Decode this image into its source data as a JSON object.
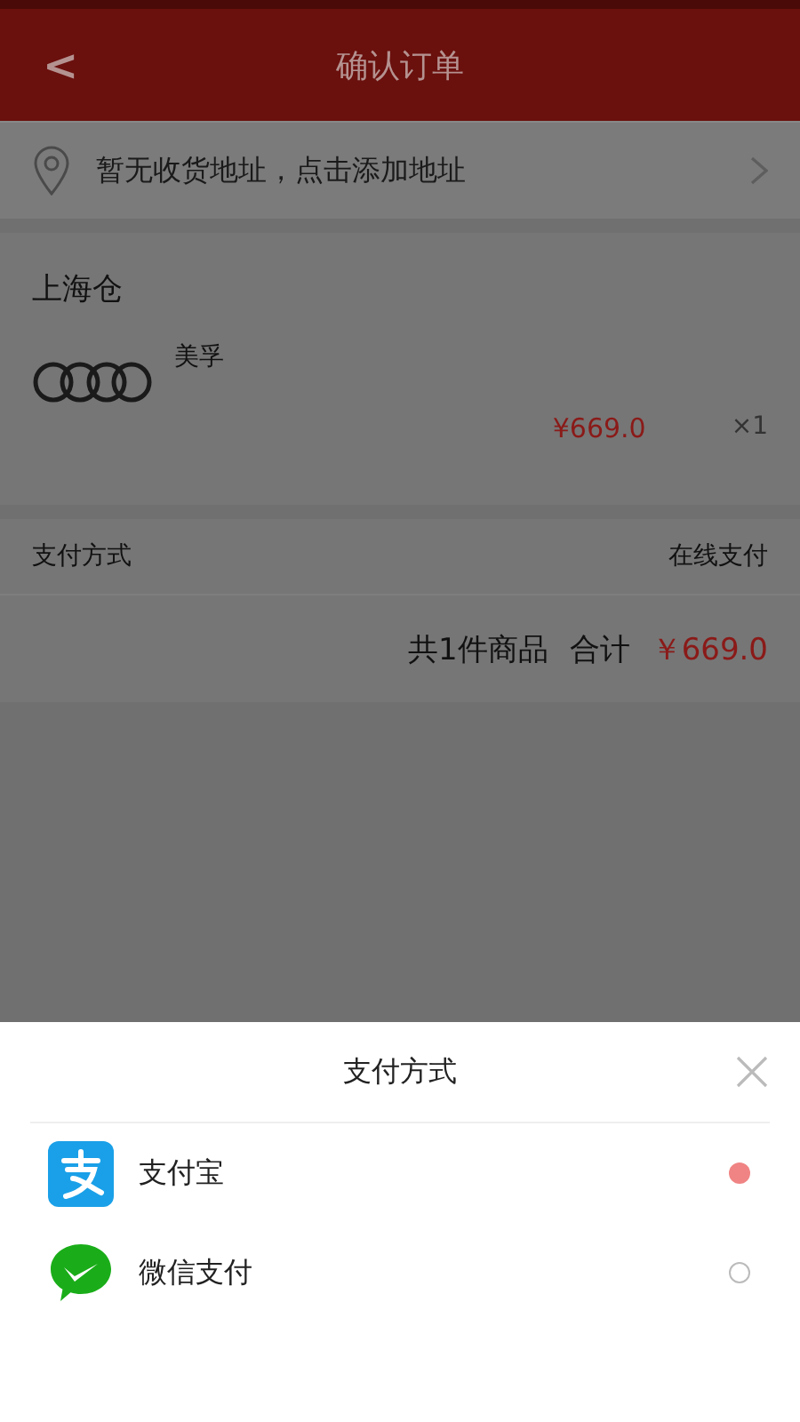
{
  "header": {
    "back": "<",
    "title": "确认订单"
  },
  "address": {
    "text": "暂无收货地址，点击添加地址"
  },
  "order": {
    "warehouse": "上海仓",
    "items": [
      {
        "name": "美孚",
        "price": "¥669.0",
        "quantity": "×1"
      }
    ],
    "payment_label": "支付方式",
    "payment_value": "在线支付",
    "count_text": "共1件商品",
    "total_label": "合计",
    "total": "￥669.0"
  },
  "sheet": {
    "title": "支付方式",
    "options": [
      {
        "kind": "alipay",
        "label": "支付宝",
        "selected": true
      },
      {
        "kind": "wechat",
        "label": "微信支付",
        "selected": false
      }
    ]
  }
}
